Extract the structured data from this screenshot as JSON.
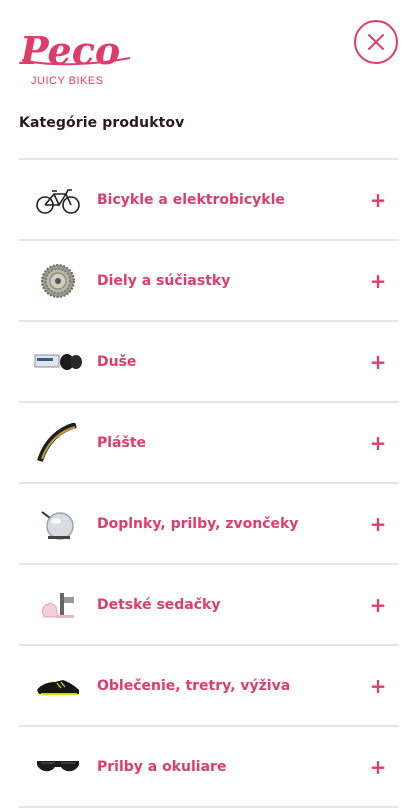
{
  "brand": {
    "logo_text": "Peco",
    "tagline": "JUICY BIKES",
    "accent_color": "#e03c6b"
  },
  "header": {
    "close_icon": "close-icon"
  },
  "categories_title": "Kategórie produktov",
  "categories": [
    {
      "label": "Bicykle a elektrobicykle",
      "icon": "bicycle-icon",
      "expand": "+"
    },
    {
      "label": "Diely a súčiastky",
      "icon": "cassette-icon",
      "expand": "+"
    },
    {
      "label": "Duše",
      "icon": "inner-tube-icon",
      "expand": "+"
    },
    {
      "label": "Plášte",
      "icon": "tire-icon",
      "expand": "+"
    },
    {
      "label": "Doplnky, prilby, zvončeky",
      "icon": "bell-icon",
      "expand": "+"
    },
    {
      "label": "Detské sedačky",
      "icon": "child-seat-icon",
      "expand": "+"
    },
    {
      "label": "Oblečenie, tretry, výživa",
      "icon": "cycling-shoe-icon",
      "expand": "+"
    },
    {
      "label": "Prilby a okuliare",
      "icon": "sunglasses-icon",
      "expand": "+"
    }
  ]
}
